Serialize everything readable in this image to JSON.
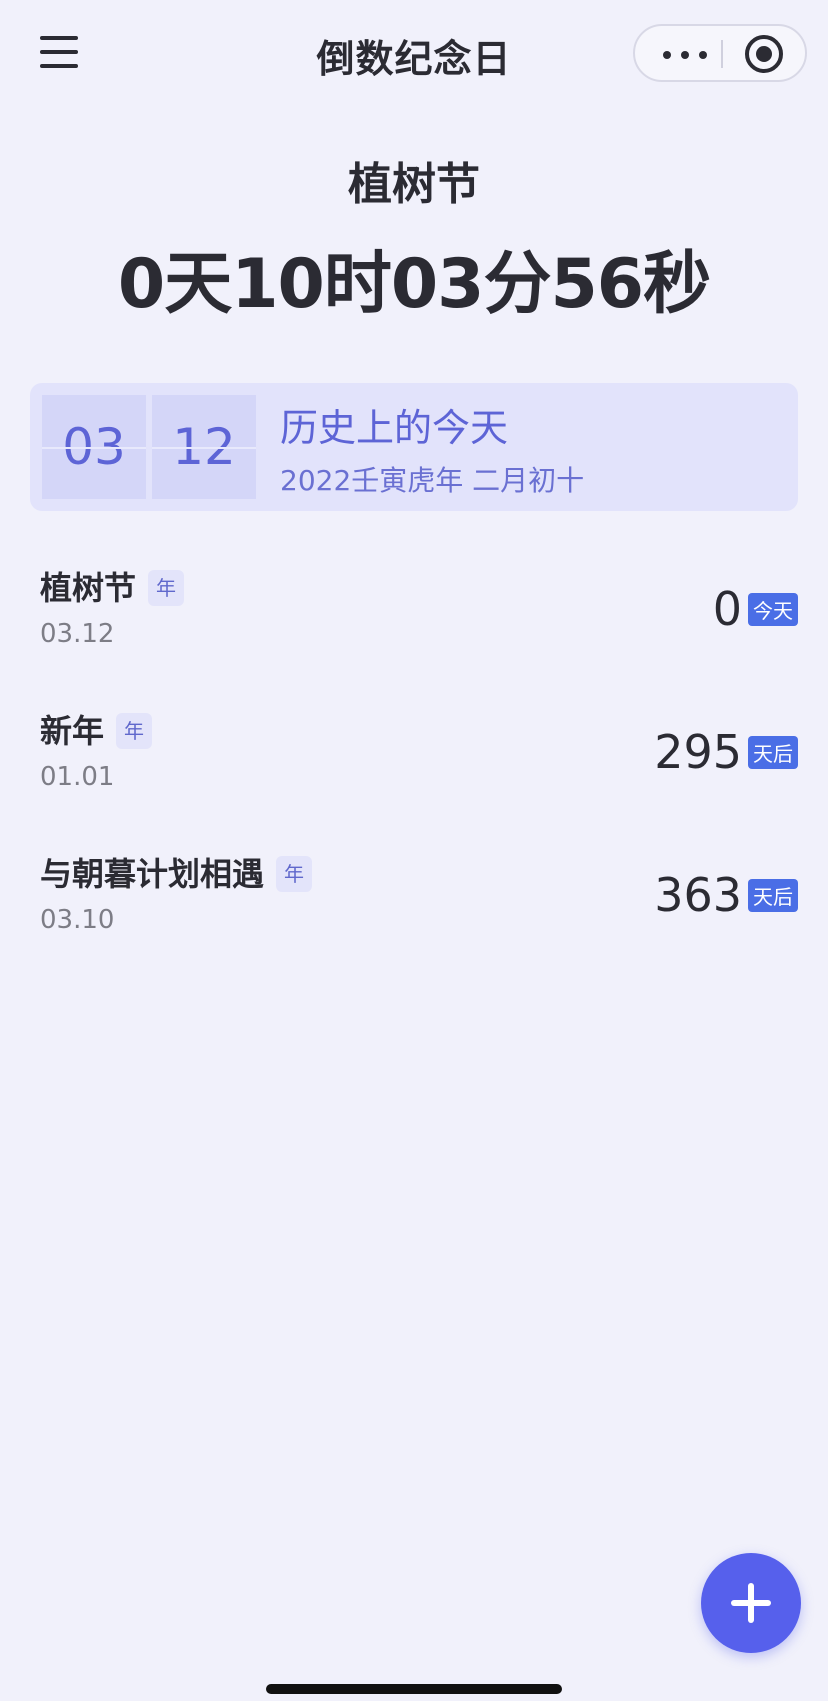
{
  "header": {
    "title": "倒数纪念日",
    "menu_icon": "hamburger-menu-icon",
    "more_icon": "more-dots-icon",
    "close_icon": "target-circle-icon"
  },
  "featured": {
    "name": "植树节",
    "countdown": "0天10时03分56秒"
  },
  "today_card": {
    "month": "03",
    "day": "12",
    "title": "历史上的今天",
    "lunar_date": "2022壬寅虎年 二月初十"
  },
  "events": [
    {
      "name": "植树节",
      "tag": "年",
      "date": "03.12",
      "days": "0",
      "unit": "今天"
    },
    {
      "name": "新年",
      "tag": "年",
      "date": "01.01",
      "days": "295",
      "unit": "天后"
    },
    {
      "name": "与朝暮计划相遇",
      "tag": "年",
      "date": "03.10",
      "days": "363",
      "unit": "天后"
    }
  ],
  "fab": {
    "icon": "plus-icon"
  },
  "colors": {
    "background": "#f1f1fb",
    "accent": "#5660ec",
    "badge": "#4a6ee6",
    "card": "#e2e3fb"
  }
}
